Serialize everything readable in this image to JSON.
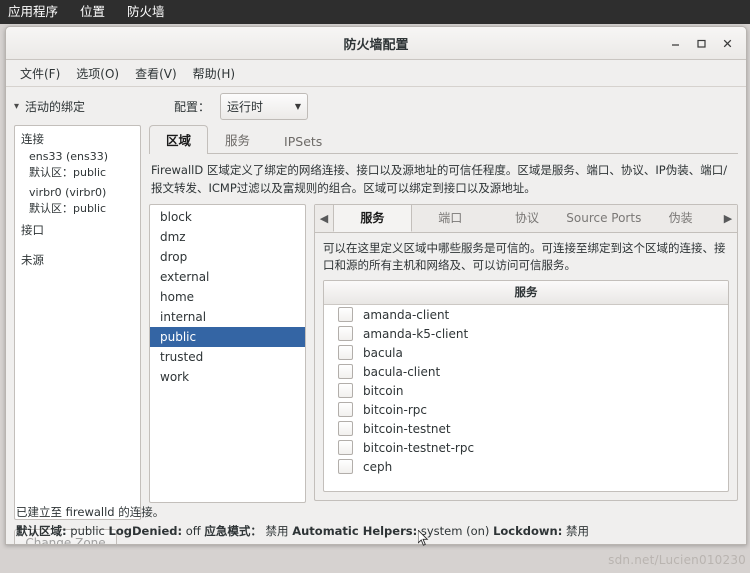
{
  "desktop_panel": {
    "items": [
      {
        "label": "应用程序"
      },
      {
        "label": "位置"
      },
      {
        "label": "防火墙"
      }
    ]
  },
  "window": {
    "title": "防火墙配置",
    "buttons": {
      "minimize": "minimize",
      "maximize": "maximize",
      "close": "close"
    }
  },
  "menubar": {
    "items": [
      {
        "label": "文件(F)"
      },
      {
        "label": "选项(O)"
      },
      {
        "label": "查看(V)"
      },
      {
        "label": "帮助(H)"
      }
    ]
  },
  "toolbar": {
    "binding_label": "活动的绑定",
    "config_label": "配置：",
    "config_value": "运行时"
  },
  "left_pane": {
    "sections": [
      {
        "title": "连接",
        "nodes": [
          {
            "name": "ens33 (ens33)",
            "detail": "默认区：public"
          },
          {
            "name": "virbr0 (virbr0)",
            "detail": "默认区：public"
          }
        ]
      },
      {
        "title": "接口",
        "nodes": []
      },
      {
        "title": "未源",
        "nodes": []
      }
    ],
    "change_zone_button": "Change Zone"
  },
  "main_tabs": [
    {
      "label": "区域",
      "active": true
    },
    {
      "label": "服务",
      "active": false
    },
    {
      "label": "IPSets",
      "active": false
    }
  ],
  "main_description": "FirewallD 区域定义了绑定的网络连接、接口以及源地址的可信任程度。区域是服务、端口、协议、IP伪装、端口/报文转发、ICMP过滤以及富规则的组合。区域可以绑定到接口以及源地址。",
  "zones": [
    {
      "label": "block",
      "selected": false
    },
    {
      "label": "dmz",
      "selected": false
    },
    {
      "label": "drop",
      "selected": false
    },
    {
      "label": "external",
      "selected": false
    },
    {
      "label": "home",
      "selected": false
    },
    {
      "label": "internal",
      "selected": false
    },
    {
      "label": "public",
      "selected": true
    },
    {
      "label": "trusted",
      "selected": false
    },
    {
      "label": "work",
      "selected": false
    }
  ],
  "inner_tabs": {
    "left_arrow": "◀",
    "right_arrow": "▶",
    "items": [
      {
        "label": "服务",
        "active": true
      },
      {
        "label": "端口",
        "active": false
      },
      {
        "label": "协议",
        "active": false
      },
      {
        "label": "Source Ports",
        "active": false
      },
      {
        "label": "伪装",
        "active": false
      }
    ]
  },
  "inner_description": "可以在这里定义区域中哪些服务是可信的。可连接至绑定到这个区域的连接、接口和源的所有主机和网络及、可以访问可信服务。",
  "services": {
    "header": "服务",
    "items": [
      {
        "label": "amanda-client",
        "checked": false
      },
      {
        "label": "amanda-k5-client",
        "checked": false
      },
      {
        "label": "bacula",
        "checked": false
      },
      {
        "label": "bacula-client",
        "checked": false
      },
      {
        "label": "bitcoin",
        "checked": false
      },
      {
        "label": "bitcoin-rpc",
        "checked": false
      },
      {
        "label": "bitcoin-testnet",
        "checked": false
      },
      {
        "label": "bitcoin-testnet-rpc",
        "checked": false
      },
      {
        "label": "ceph",
        "checked": false
      }
    ]
  },
  "statusbar": {
    "connection": "已建立至 firewalld 的连接。",
    "default_zone_label": "默认区域:",
    "default_zone_value": "public",
    "logdenied_label": "LogDenied:",
    "logdenied_value": "off",
    "panic_label": "应急模式：",
    "panic_value": "禁用",
    "helpers_label": "Automatic Helpers:",
    "helpers_value": "system (on)",
    "lockdown_label": "Lockdown:",
    "lockdown_value": "禁用"
  },
  "watermark": "sdn.net/Lucien010230"
}
